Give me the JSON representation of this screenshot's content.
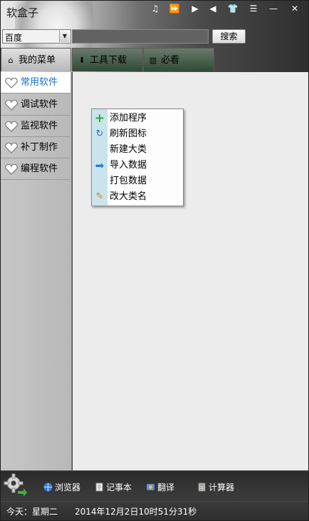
{
  "window": {
    "title": "软盒子"
  },
  "titlebar_buttons": [
    {
      "icon": "music-note-icon",
      "glyph": "♫"
    },
    {
      "icon": "fast-forward-icon",
      "glyph": "⏩"
    },
    {
      "icon": "play-icon",
      "glyph": "▶"
    },
    {
      "icon": "volume-icon",
      "glyph": "◀"
    },
    {
      "icon": "tshirt-skin-icon",
      "glyph": "👕"
    },
    {
      "icon": "menu-icon",
      "glyph": "☰"
    },
    {
      "icon": "minimize-icon",
      "glyph": "—"
    },
    {
      "icon": "close-icon",
      "glyph": "✕"
    }
  ],
  "search": {
    "engine": "百度",
    "value": "",
    "button_label": "搜索"
  },
  "tabs": [
    {
      "label": "我的菜单",
      "icon": "home-icon",
      "active": true
    },
    {
      "label": "工具下载",
      "icon": "download-icon",
      "active": false
    },
    {
      "label": "必看",
      "icon": "book-icon",
      "active": false
    }
  ],
  "sidebar": {
    "items": [
      {
        "label": "常用软件",
        "active": true
      },
      {
        "label": "调试软件",
        "active": false
      },
      {
        "label": "监视软件",
        "active": false
      },
      {
        "label": "补丁制作",
        "active": false
      },
      {
        "label": "编程软件",
        "active": false
      }
    ]
  },
  "context_menu": {
    "items": [
      {
        "label": "添加程序",
        "icon": "add-icon"
      },
      {
        "label": "刷新图标",
        "icon": "refresh-icon"
      },
      {
        "label": "新建大类",
        "icon": ""
      },
      {
        "label": "导入数据",
        "icon": "import-arrow-icon"
      },
      {
        "label": "打包数据",
        "icon": ""
      },
      {
        "label": "改大类名",
        "icon": "pencil-icon"
      }
    ]
  },
  "bottom_tools": [
    {
      "label": "浏览器",
      "icon": "browser-globe-icon"
    },
    {
      "label": "记事本",
      "icon": "notepad-icon"
    },
    {
      "label": "翻译",
      "icon": "translate-icon"
    },
    {
      "label": "计算器",
      "icon": "calculator-icon"
    }
  ],
  "status": {
    "today": "今天：星期二",
    "datetime": "2014年12月2日10时51分31秒"
  },
  "colors": {
    "accent": "#1a6fc9",
    "add_green": "#2ea82e",
    "menu_strip": "#c9e4ea"
  }
}
